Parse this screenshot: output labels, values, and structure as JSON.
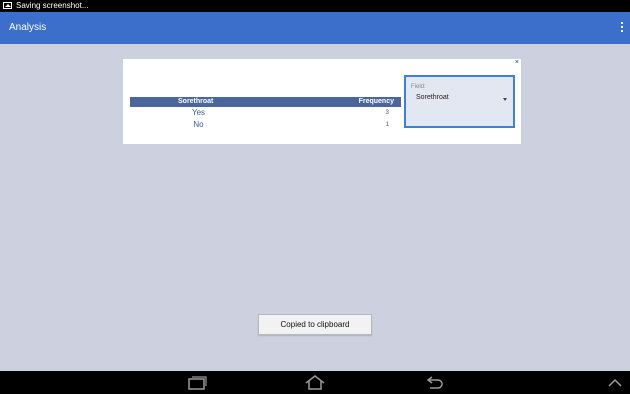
{
  "status_bar": {
    "notification_text": "Saving screenshot...",
    "icon": "image-icon"
  },
  "action_bar": {
    "title": "Analysis",
    "overflow_icon": "overflow-menu-icon"
  },
  "card": {
    "close_label": "×",
    "table": {
      "headers": [
        "Sorethroat",
        "Frequency"
      ],
      "rows": [
        {
          "value": "Yes",
          "frequency": "3"
        },
        {
          "value": "No",
          "frequency": "1"
        }
      ]
    },
    "field_selector": {
      "label": "Field:",
      "value": "Sorethroat",
      "icon": "dropdown-arrow-icon"
    }
  },
  "toast": {
    "text": "Copied to clipboard"
  },
  "nav_bar": {
    "buttons": [
      "recent-apps-icon",
      "home-icon",
      "back-icon",
      "expand-up-icon"
    ]
  },
  "colors": {
    "action_bar": "#3b6fcb",
    "table_header": "#4a669b",
    "background": "#cdd1df",
    "field_border": "#3f7fd4"
  }
}
